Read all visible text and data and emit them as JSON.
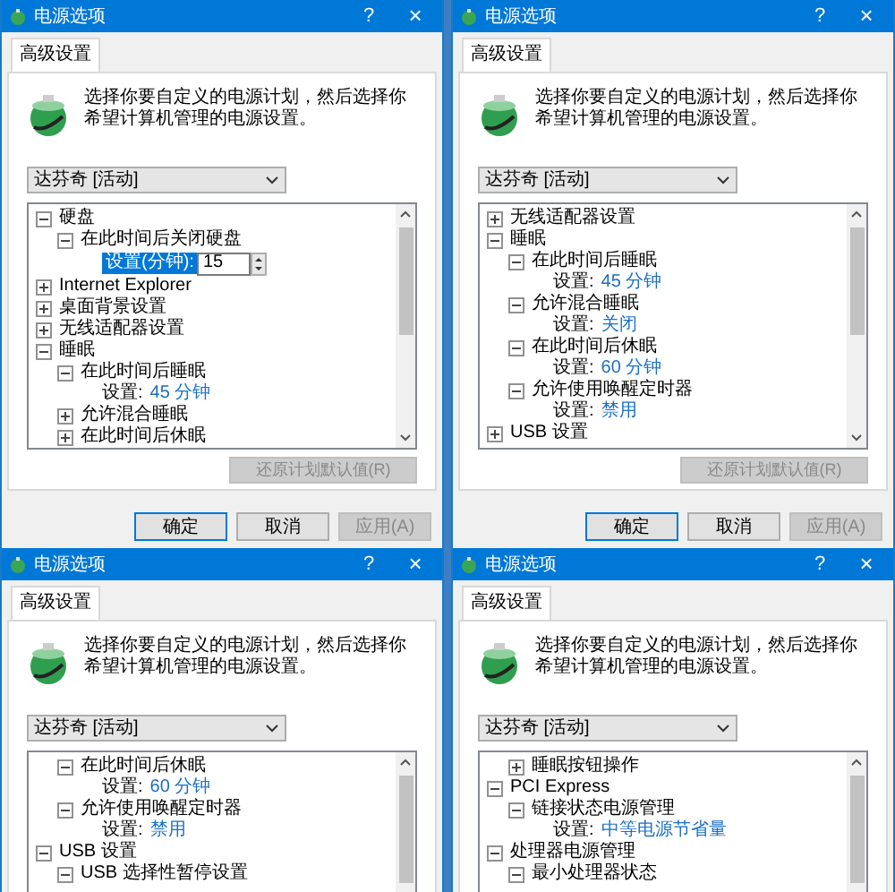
{
  "dialogs": [
    {
      "title": "电源选项",
      "help": "?",
      "close": "×",
      "tab": "高级设置",
      "description": "选择你要自定义的电源计划，然后选择你希望计算机管理的电源设置。",
      "plan": "达芬奇 [活动]",
      "tree": [
        {
          "kind": "group",
          "label": "硬盘",
          "expanded": true,
          "children": [
            {
              "kind": "group",
              "label": "在此时间后关闭硬盘",
              "expanded": true,
              "children": [
                {
                  "kind": "editor",
                  "label": "设置(分钟):",
                  "value": "15"
                }
              ]
            }
          ]
        },
        {
          "kind": "group",
          "label": "Internet Explorer",
          "expanded": false
        },
        {
          "kind": "group",
          "label": "桌面背景设置",
          "expanded": false
        },
        {
          "kind": "group",
          "label": "无线适配器设置",
          "expanded": false
        },
        {
          "kind": "group",
          "label": "睡眠",
          "expanded": true,
          "children": [
            {
              "kind": "group",
              "label": "在此时间后睡眠",
              "expanded": true,
              "children": [
                {
                  "kind": "setting",
                  "label": "设置:",
                  "value": "45 分钟"
                }
              ]
            },
            {
              "kind": "group",
              "label": "允许混合睡眠",
              "expanded": false
            },
            {
              "kind": "group",
              "label": "在此时间后休眠",
              "expanded": false
            }
          ]
        }
      ],
      "restore": {
        "label": "还原计划默认值(R)",
        "disabled": true
      },
      "buttons": [
        {
          "label": "确定",
          "default": true,
          "disabled": false
        },
        {
          "label": "取消",
          "default": false,
          "disabled": false
        },
        {
          "label": "应用(A)",
          "default": false,
          "disabled": true
        }
      ]
    },
    {
      "title": "电源选项",
      "help": "?",
      "close": "×",
      "tab": "高级设置",
      "description": "选择你要自定义的电源计划，然后选择你希望计算机管理的电源设置。",
      "plan": "达芬奇 [活动]",
      "tree": [
        {
          "kind": "group",
          "label": "无线适配器设置",
          "expanded": false
        },
        {
          "kind": "group",
          "label": "睡眠",
          "expanded": true,
          "children": [
            {
              "kind": "group",
              "label": "在此时间后睡眠",
              "expanded": true,
              "children": [
                {
                  "kind": "setting",
                  "label": "设置:",
                  "value": "45 分钟"
                }
              ]
            },
            {
              "kind": "group",
              "label": "允许混合睡眠",
              "expanded": true,
              "children": [
                {
                  "kind": "setting",
                  "label": "设置:",
                  "value": "关闭"
                }
              ]
            },
            {
              "kind": "group",
              "label": "在此时间后休眠",
              "expanded": true,
              "children": [
                {
                  "kind": "setting",
                  "label": "设置:",
                  "value": "60 分钟"
                }
              ]
            },
            {
              "kind": "group",
              "label": "允许使用唤醒定时器",
              "expanded": true,
              "children": [
                {
                  "kind": "setting",
                  "label": "设置:",
                  "value": "禁用"
                }
              ]
            }
          ]
        },
        {
          "kind": "group",
          "label": "USB 设置",
          "expanded": false
        }
      ],
      "restore": {
        "label": "还原计划默认值(R)",
        "disabled": true
      },
      "buttons": [
        {
          "label": "确定",
          "default": true,
          "disabled": false
        },
        {
          "label": "取消",
          "default": false,
          "disabled": false
        },
        {
          "label": "应用(A)",
          "default": false,
          "disabled": true
        }
      ]
    },
    {
      "title": "电源选项",
      "help": "?",
      "close": "×",
      "tab": "高级设置",
      "description": "选择你要自定义的电源计划，然后选择你希望计算机管理的电源设置。",
      "plan": "达芬奇 [活动]",
      "tree": [
        {
          "kind": "continued",
          "children": [
            {
              "kind": "group",
              "label": "在此时间后休眠",
              "expanded": true,
              "children": [
                {
                  "kind": "setting",
                  "label": "设置:",
                  "value": "60 分钟"
                }
              ]
            },
            {
              "kind": "group",
              "label": "允许使用唤醒定时器",
              "expanded": true,
              "children": [
                {
                  "kind": "setting",
                  "label": "设置:",
                  "value": "禁用"
                }
              ]
            }
          ]
        },
        {
          "kind": "group",
          "label": "USB 设置",
          "expanded": true,
          "children": [
            {
              "kind": "group",
              "label": "USB 选择性暂停设置",
              "expanded": true
            }
          ]
        }
      ]
    },
    {
      "title": "电源选项",
      "help": "?",
      "close": "×",
      "tab": "高级设置",
      "description": "选择你要自定义的电源计划，然后选择你希望计算机管理的电源设置。",
      "plan": "达芬奇 [活动]",
      "tree": [
        {
          "kind": "continued",
          "children": [
            {
              "kind": "group",
              "label": "睡眠按钮操作",
              "expanded": false
            }
          ]
        },
        {
          "kind": "group",
          "label": "PCI Express",
          "expanded": true,
          "children": [
            {
              "kind": "group",
              "label": "链接状态电源管理",
              "expanded": true,
              "children": [
                {
                  "kind": "setting",
                  "label": "设置:",
                  "value": "中等电源节省量"
                }
              ]
            }
          ]
        },
        {
          "kind": "group",
          "label": "处理器电源管理",
          "expanded": true,
          "children": [
            {
              "kind": "group",
              "label": "最小处理器状态",
              "expanded": true
            }
          ]
        }
      ]
    }
  ]
}
